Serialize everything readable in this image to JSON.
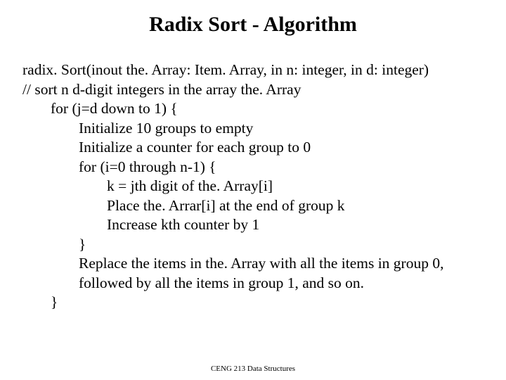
{
  "title": "Radix Sort - Algorithm",
  "lines": {
    "l1": "radix. Sort(inout the. Array: Item. Array, in n: integer, in d: integer)",
    "l2": "// sort n d-digit integers in the array the. Array",
    "l3": "for (j=d down to 1) {",
    "l4": "Initialize 10 groups to empty",
    "l5": "Initialize a counter for each group to 0",
    "l6": "for (i=0 through n-1) {",
    "l7": "k = jth digit of the. Array[i]",
    "l8": "Place the. Arrar[i] at the end of group k",
    "l9": "Increase kth counter by 1",
    "l10": "}",
    "l11": "Replace the items  in the. Array with all the items in group 0,",
    "l12": "followed by all the items in group 1, and so on.",
    "l13": "}"
  },
  "footer": "CENG 213 Data Structures"
}
